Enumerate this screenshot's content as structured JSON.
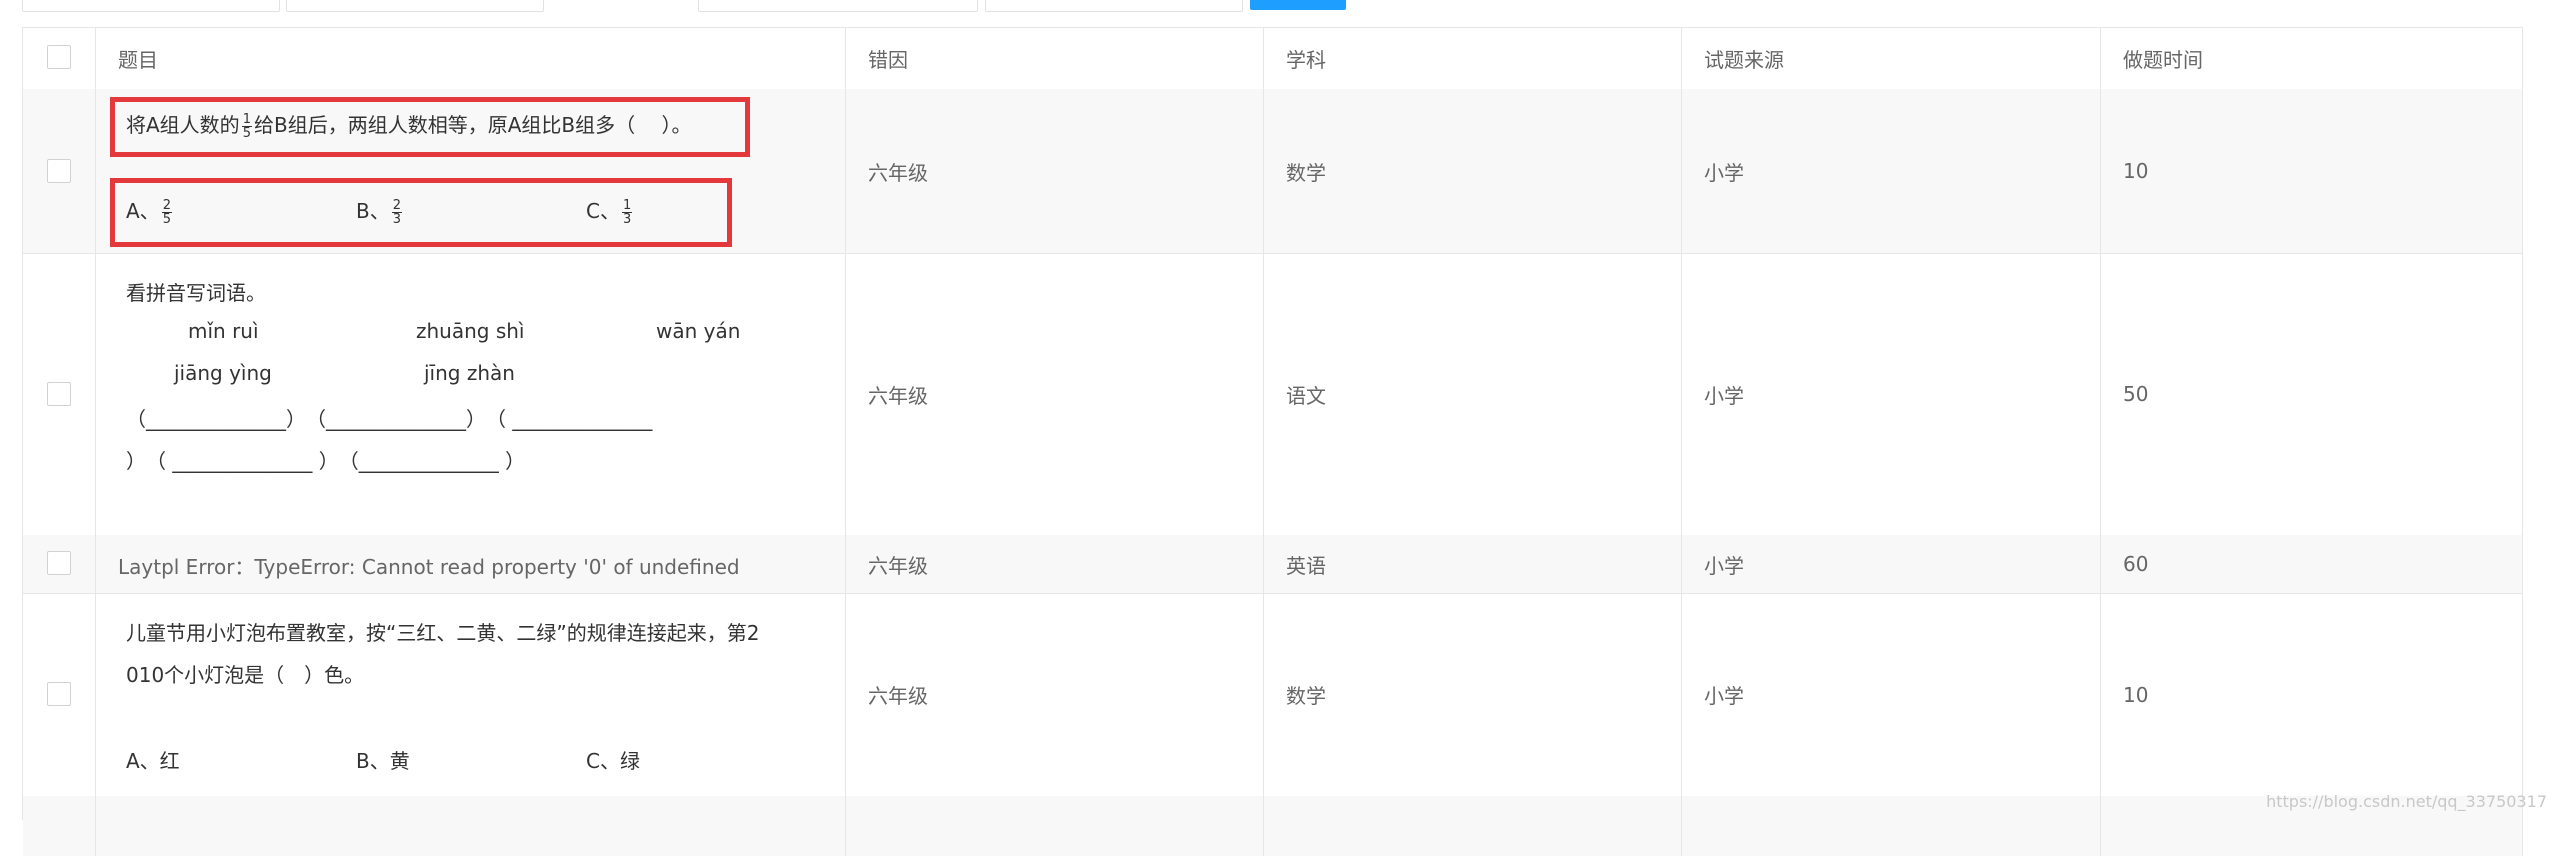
{
  "header": {
    "title": "题目",
    "reason": "错因",
    "subject": "学科",
    "source": "试题来源",
    "time": "做题时间"
  },
  "rows": [
    {
      "q_pre": "将A组人数的",
      "q_frac_num": "1",
      "q_frac_den": "5",
      "q_post": "给B组后，两组人数相等，原A组比B组多（　 ）。",
      "optA_label": "A、",
      "optA_num": "2",
      "optA_den": "5",
      "optB_label": "B、",
      "optB_num": "2",
      "optB_den": "3",
      "optC_label": "C、",
      "optC_num": "1",
      "optC_den": "3",
      "reason": "六年级",
      "subject": "数学",
      "source": "小学",
      "time": "10"
    },
    {
      "title": "看拼音写词语。",
      "p1": "mǐn ruì",
      "p2": "zhuāng shì",
      "p3": "wān yán",
      "p4": "jiāng yìng",
      "p5": "jīng zhàn",
      "blanks1": "（______________）　（______________）　（ ______________",
      "blanks2": "）　（ ______________ ）　（______________ ）",
      "reason": "六年级",
      "subject": "语文",
      "source": "小学",
      "time": "50"
    },
    {
      "error": "Laytpl Error：TypeError: Cannot read property '0' of undefined",
      "reason": "六年级",
      "subject": "英语",
      "source": "小学",
      "time": "60"
    },
    {
      "line1": "儿童节用小灯泡布置教室，按“三红、二黄、二绿”的规律连接起来，第2",
      "line2": "010个小灯泡是（　）色。",
      "optA": "A、红",
      "optB": "B、黄",
      "optC": "C、绿",
      "reason": "六年级",
      "subject": "数学",
      "source": "小学",
      "time": "10"
    }
  ],
  "watermark": "https://blog.csdn.net/qq_33750317",
  "colors": {
    "border": "#e6e6e6",
    "header_text": "#666666",
    "highlight_box": "#e4393c",
    "primary_button": "#1E9FFF"
  }
}
